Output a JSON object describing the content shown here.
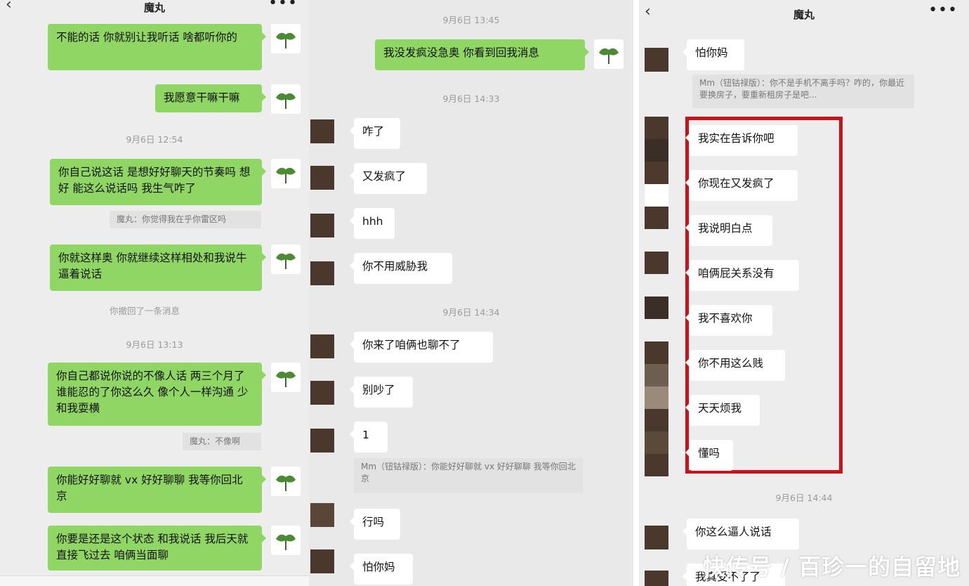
{
  "panel1": {
    "header": {
      "back": "‹",
      "title": "魔丸",
      "more": "•••"
    },
    "messages": [
      "不能的话 你就别让我听话 啥都听你的",
      "我愿意干嘛干嘛",
      "你自己说这话 是想好好聊天的节奏吗 想好 能这么说话吗 我生气咋了",
      "你就这样奥 你就继续这样相处和我说牛逼着说话",
      "你自己都说你说的不像人话 两三个月了 谁能忍的了你这么久 像个人一样沟通 少和我耍横",
      "你能好好聊就 vx 好好聊聊 我等你回北京",
      "你要是还是这个状态 和我说话 我后天就直接飞过去 咱俩当面聊"
    ],
    "timestamps": [
      "9月6日 12:54",
      "9月6日 13:13"
    ],
    "quotes": [
      "魔丸：你觉得我在乎你雷区吗",
      "魔丸：不像啊"
    ],
    "system": "你撤回了一条消息"
  },
  "panel2": {
    "timestamps": [
      "9月6日 13:45",
      "9月6日 14:33",
      "9月6日 14:34"
    ],
    "sent": [
      "我没发疯没急奥 你看到回我消息"
    ],
    "received": [
      "咋了",
      "又发疯了",
      "hhh",
      "你不用威胁我",
      "你来了咱俩也聊不了",
      "别吵了",
      "1",
      "行吗",
      "怕你妈"
    ],
    "quote": "Mm（钮钴禄版）：你能好好聊就 vx 好好聊聊 我等你回北京"
  },
  "panel3": {
    "header": {
      "back": "‹",
      "title": "魔丸",
      "more": "•••"
    },
    "first": "怕你妈",
    "quote": "Mm（钮钴禄版）：你不是手机不离手吗？咋的，你最近要换房子，要重新租房子是吧...",
    "boxed": [
      "我实在告诉你吧",
      "你现在又发疯了",
      "我说明白点",
      "咱俩屁关系没有",
      "我不喜欢你",
      "你不用这么贱",
      "天天烦我",
      "懂吗"
    ],
    "timestamp": "9月6日 14:44",
    "after": [
      "你这么逼人说话",
      "我真受不了了"
    ]
  },
  "watermark": "快传号 / 百珍一的自留地",
  "colors": {
    "sent_bubble": "#8fd664",
    "received_bubble": "#ffffff",
    "highlight_box": "#c7141b"
  }
}
